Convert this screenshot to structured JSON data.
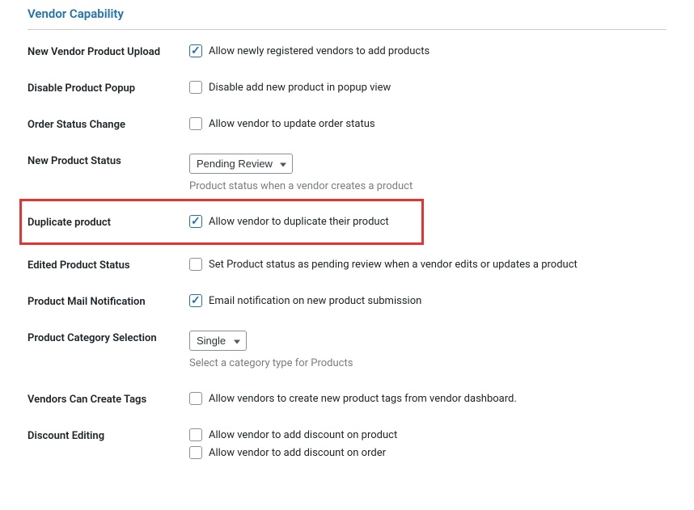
{
  "section": {
    "title": "Vendor Capability"
  },
  "rows": {
    "upload": {
      "label": "New Vendor Product Upload",
      "check_text": "Allow newly registered vendors to add products"
    },
    "popup": {
      "label": "Disable Product Popup",
      "check_text": "Disable add new product in popup view"
    },
    "order_status": {
      "label": "Order Status Change",
      "check_text": "Allow vendor to update order status"
    },
    "new_status": {
      "label": "New Product Status",
      "selected": "Pending Review",
      "desc": "Product status when a vendor creates a product"
    },
    "duplicate": {
      "label": "Duplicate product",
      "check_text": "Allow vendor to duplicate their product"
    },
    "edited_status": {
      "label": "Edited Product Status",
      "check_text": "Set Product status as pending review when a vendor edits or updates a product"
    },
    "mail": {
      "label": "Product Mail Notification",
      "check_text": "Email notification on new product submission"
    },
    "category": {
      "label": "Product Category Selection",
      "selected": "Single",
      "desc": "Select a category type for Products"
    },
    "tags": {
      "label": "Vendors Can Create Tags",
      "check_text": "Allow vendors to create new product tags from vendor dashboard."
    },
    "discount": {
      "label": "Discount Editing",
      "check1": "Allow vendor to add discount on product",
      "check2": "Allow vendor to add discount on order"
    }
  }
}
